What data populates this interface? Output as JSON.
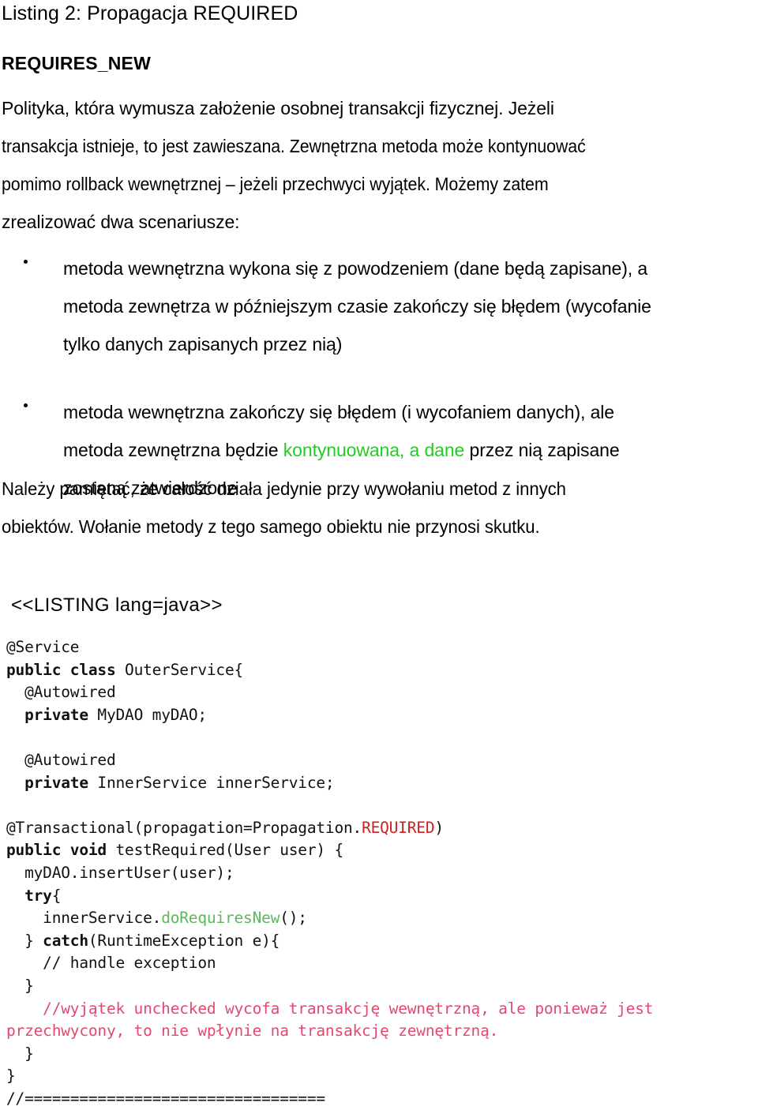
{
  "document": {
    "listing_caption": "Listing 2: Propagacja REQUIRED",
    "heading": "REQUIRES_NEW",
    "intro_paragraph": {
      "lines": [
        "Polityka, która wymusza założenie osobnej transakcji fizycznej. Jeżeli",
        "transakcja istnieje, to jest zawieszana. Zewnętrzna metoda może kontynuować",
        "pomimo rollback wewnętrznej – jeżeli przechwyci wyjątek. Możemy zatem",
        "zrealizować dwa scenariusze:"
      ]
    },
    "bullets": [
      {
        "marker": "•",
        "lines": [
          {
            "segments": [
              {
                "text": "metoda wewnętrzna wykona się z powodzeniem (dane będą zapisane), a",
                "style": "normal"
              }
            ]
          },
          {
            "segments": [
              {
                "text": "metoda zewnętrza w późniejszym czasie zakończy się błędem (wycofanie",
                "style": "normal"
              }
            ]
          },
          {
            "segments": [
              {
                "text": "tylko danych zapisanych przez nią)",
                "style": "normal"
              }
            ]
          }
        ]
      },
      {
        "marker": "•",
        "lines": [
          {
            "segments": [
              {
                "text": "metoda wewnętrzna zakończy się błędem (i wycofaniem danych), ale",
                "style": "normal"
              }
            ]
          },
          {
            "segments": [
              {
                "text": "metoda zewnętrzna będzie ",
                "style": "normal"
              },
              {
                "text": "kontynuowana, a dane",
                "style": "green"
              },
              {
                "text": " przez nią zapisane",
                "style": "normal"
              }
            ]
          },
          {
            "segments": [
              {
                "text": "zostaną zatwierdzone",
                "style": "normal"
              }
            ]
          }
        ]
      }
    ],
    "note_paragraph": {
      "lines": [
        "Należy pamiętać, że całość działa jedynie przy wywołaniu metod z innych",
        "obiektów. Wołanie metody z tego samego obiektu nie przynosi skutku."
      ]
    },
    "listing_tag": "<<LISTING lang=java>>",
    "code_lines": [
      {
        "segments": [
          {
            "text": "@Service",
            "style": "plain"
          }
        ]
      },
      {
        "segments": [
          {
            "text": "public class",
            "style": "keyword"
          },
          {
            "text": " OuterService{",
            "style": "plain"
          }
        ]
      },
      {
        "segments": [
          {
            "text": "  @Autowired",
            "style": "plain"
          }
        ]
      },
      {
        "segments": [
          {
            "text": "  ",
            "style": "plain"
          },
          {
            "text": "private",
            "style": "keyword"
          },
          {
            "text": " MyDAO myDAO;",
            "style": "plain"
          }
        ]
      },
      {
        "segments": [
          {
            "text": "",
            "style": "plain"
          }
        ]
      },
      {
        "segments": [
          {
            "text": "  @Autowired",
            "style": "plain"
          }
        ]
      },
      {
        "segments": [
          {
            "text": "  ",
            "style": "plain"
          },
          {
            "text": "private",
            "style": "keyword"
          },
          {
            "text": " InnerService innerService;",
            "style": "plain"
          }
        ]
      },
      {
        "segments": [
          {
            "text": "",
            "style": "plain"
          }
        ]
      },
      {
        "segments": [
          {
            "text": "@Transactional(propagation=Propagation.",
            "style": "plain"
          },
          {
            "text": "REQUIRED",
            "style": "red"
          },
          {
            "text": ")",
            "style": "plain"
          }
        ]
      },
      {
        "segments": [
          {
            "text": "public void",
            "style": "keyword"
          },
          {
            "text": " testRequired(User user) {",
            "style": "plain"
          }
        ]
      },
      {
        "segments": [
          {
            "text": "  myDAO.insertUser(user);",
            "style": "plain"
          }
        ]
      },
      {
        "segments": [
          {
            "text": "  ",
            "style": "plain"
          },
          {
            "text": "try",
            "style": "keyword"
          },
          {
            "text": "{",
            "style": "plain"
          }
        ]
      },
      {
        "segments": [
          {
            "text": "    innerService.",
            "style": "plain"
          },
          {
            "text": "doRequiresNew",
            "style": "green"
          },
          {
            "text": "();",
            "style": "plain"
          }
        ]
      },
      {
        "segments": [
          {
            "text": "  } ",
            "style": "plain"
          },
          {
            "text": "catch",
            "style": "keyword"
          },
          {
            "text": "(RuntimeException e){",
            "style": "plain"
          }
        ]
      },
      {
        "segments": [
          {
            "text": "    // handle exception",
            "style": "plain"
          }
        ]
      },
      {
        "segments": [
          {
            "text": "  }",
            "style": "plain"
          }
        ]
      },
      {
        "segments": [
          {
            "text": "    //wyjątek unchecked wycofa transakcję wewnętrzną, ale ponieważ jest",
            "style": "pink"
          }
        ]
      },
      {
        "segments": [
          {
            "text": "przechwycony, to nie wpłynie na transakcję zewnętrzną.",
            "style": "pink"
          }
        ]
      },
      {
        "segments": [
          {
            "text": "  }",
            "style": "plain"
          }
        ]
      },
      {
        "segments": [
          {
            "text": "}",
            "style": "plain"
          }
        ]
      },
      {
        "segments": [
          {
            "text": "//=================================",
            "style": "plain"
          }
        ]
      }
    ]
  },
  "colors": {
    "text": "#000000",
    "background": "#ffffff",
    "highlight_green": "#22cc22",
    "code_green": "#5cb85c",
    "code_red": "#cc2222",
    "code_pink": "#e2496f"
  }
}
